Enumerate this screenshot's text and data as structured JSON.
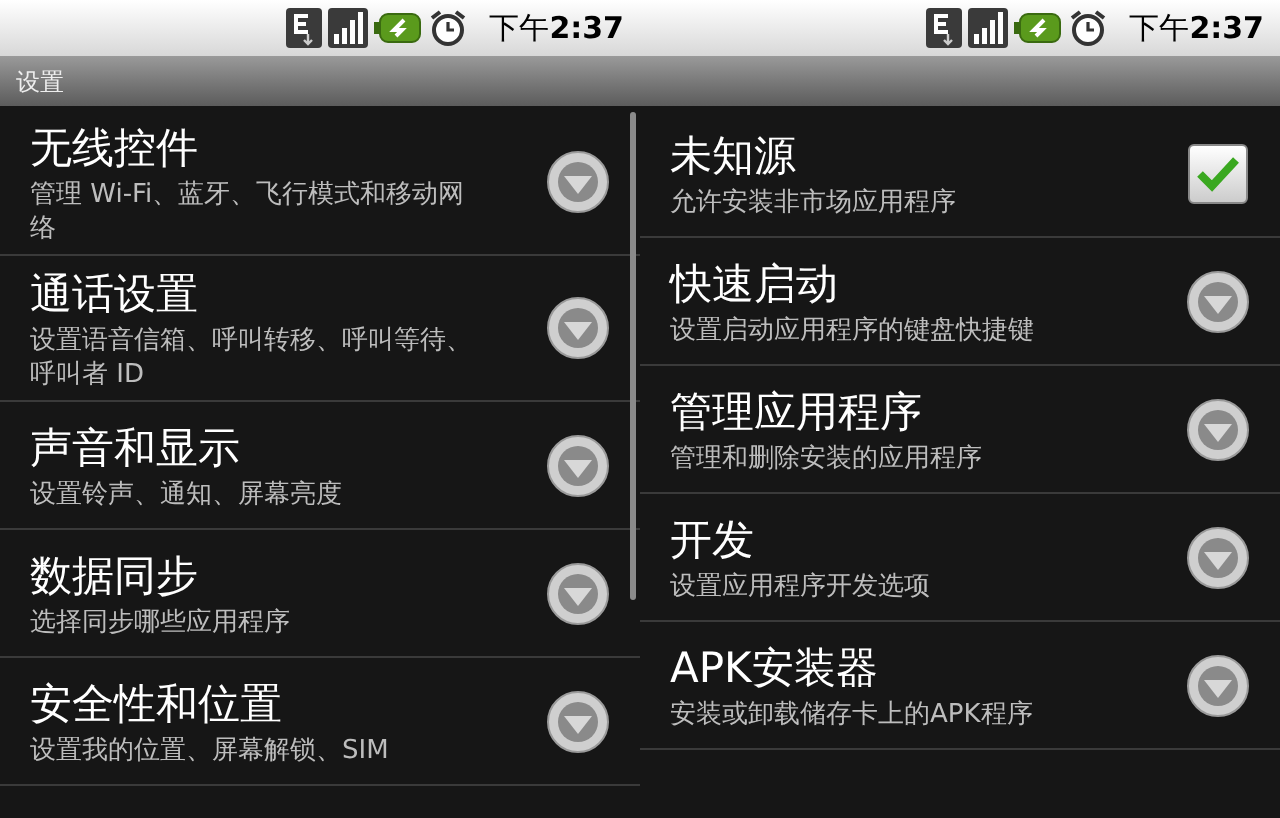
{
  "screens": [
    {
      "status_bar": {
        "time": "下午**2:37**"
      },
      "title": "设置",
      "scrollbar": true,
      "items": [
        {
          "kind": "arrow",
          "title": "无线控件",
          "summary": "管理 Wi-Fi、蓝牙、飞行模式和移动网络"
        },
        {
          "kind": "arrow",
          "title": "通话设置",
          "summary": "设置语音信箱、呼叫转移、呼叫等待、呼叫者 ID"
        },
        {
          "kind": "arrow",
          "title": "声音和显示",
          "summary": "设置铃声、通知、屏幕亮度"
        },
        {
          "kind": "arrow",
          "title": "数据同步",
          "summary": "选择同步哪些应用程序"
        },
        {
          "kind": "arrow",
          "title": "安全性和位置",
          "summary": "设置我的位置、屏幕解锁、SIM"
        }
      ]
    },
    {
      "status_bar": {
        "time": "下午**2:37**"
      },
      "scrollbar": false,
      "items": [
        {
          "kind": "checkbox",
          "title": "未知源",
          "summary": "允许安装非市场应用程序",
          "checked": true
        },
        {
          "kind": "arrow",
          "title": "快速启动",
          "summary": "设置启动应用程序的键盘快捷键"
        },
        {
          "kind": "arrow",
          "title": "管理应用程序",
          "summary": "管理和删除安装的应用程序"
        },
        {
          "kind": "arrow",
          "title": "开发",
          "summary": "设置应用程序开发选项"
        },
        {
          "kind": "arrow",
          "title": "APK安装器",
          "summary": "安装或卸载储存卡上的APK程序"
        }
      ]
    }
  ]
}
